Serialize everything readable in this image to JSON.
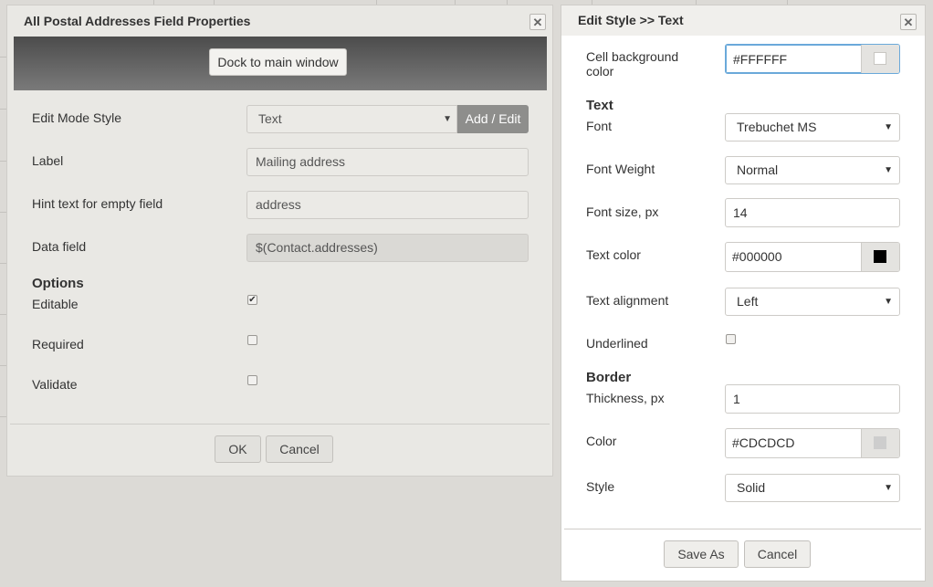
{
  "left_dialog": {
    "title": "All Postal Addresses Field Properties",
    "dock_button": "Dock to main window",
    "edit_mode_style": {
      "label": "Edit Mode Style",
      "value": "Text",
      "add_edit": "Add / Edit"
    },
    "label_field": {
      "label": "Label",
      "value": "Mailing address"
    },
    "hint_field": {
      "label": "Hint text for empty field",
      "value": "address"
    },
    "data_field": {
      "label": "Data field",
      "value": "$(Contact.addresses)"
    },
    "options": {
      "heading": "Options",
      "editable": {
        "label": "Editable",
        "checked": true
      },
      "required": {
        "label": "Required",
        "checked": false
      },
      "validate": {
        "label": "Validate",
        "checked": false
      }
    },
    "ok": "OK",
    "cancel": "Cancel"
  },
  "right_dialog": {
    "title": "Edit Style >> Text",
    "cell_bg": {
      "label_line1": "Cell background",
      "label_line2": "color",
      "value": "#FFFFFF",
      "swatch": "#FFFFFF"
    },
    "text_heading": "Text",
    "font": {
      "label": "Font",
      "value": "Trebuchet MS"
    },
    "font_weight": {
      "label": "Font Weight",
      "value": "Normal"
    },
    "font_size": {
      "label": "Font size, px",
      "value": "14"
    },
    "text_color": {
      "label": "Text color",
      "value": "#000000",
      "swatch": "#000000"
    },
    "text_alignment": {
      "label": "Text alignment",
      "value": "Left"
    },
    "underlined": {
      "label": "Underlined",
      "checked": false
    },
    "border_heading": "Border",
    "thickness": {
      "label": "Thickness, px",
      "value": "1"
    },
    "color": {
      "label": "Color",
      "value": "#CDCDCD",
      "swatch": "#CDCDCD"
    },
    "style": {
      "label": "Style",
      "value": "Solid"
    },
    "save_as": "Save As",
    "cancel": "Cancel"
  }
}
